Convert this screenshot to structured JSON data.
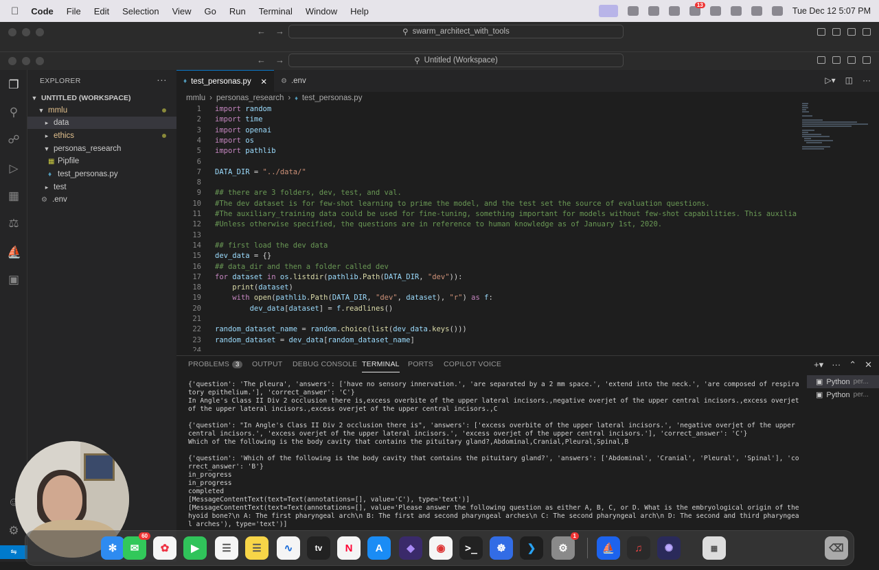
{
  "menubar": {
    "app": "Code",
    "items": [
      "File",
      "Edit",
      "Selection",
      "View",
      "Go",
      "Run",
      "Terminal",
      "Window",
      "Help"
    ],
    "tray_badge": "13",
    "datetime": "Tue Dec 12  5:07 PM"
  },
  "back_window": {
    "search": "swarm_architect_with_tools"
  },
  "window": {
    "search": "Untitled (Workspace)"
  },
  "explorer": {
    "title": "EXPLORER",
    "workspace": "UNTITLED (WORKSPACE)",
    "tree": [
      {
        "label": "mmlu",
        "type": "folder-open"
      },
      {
        "label": "data",
        "type": "folder"
      },
      {
        "label": "ethics",
        "type": "folder"
      },
      {
        "label": "personas_research",
        "type": "folder-open"
      },
      {
        "label": "Pipfile",
        "type": "file"
      },
      {
        "label": "test_personas.py",
        "type": "file"
      },
      {
        "label": "test",
        "type": "folder"
      },
      {
        "label": ".env",
        "type": "file"
      }
    ]
  },
  "tabs": [
    {
      "label": "test_personas.py",
      "active": true
    },
    {
      "label": ".env",
      "active": false
    }
  ],
  "breadcrumbs": [
    "mmlu",
    "personas_research",
    "test_personas.py"
  ],
  "code_lines": [
    "import random",
    "import time",
    "import openai",
    "import os",
    "import pathlib",
    "",
    "DATA_DIR = \"../data/\"",
    "",
    "## there are 3 folders, dev, test, and val.",
    "#The dev dataset is for few-shot learning to prime the model, and the test set the source of evaluation questions.",
    "#The auxiliary_training data could be used for fine-tuning, something important for models without few-shot capabilities. This auxiliary tra",
    "#Unless otherwise specified, the questions are in reference to human knowledge as of January 1st, 2020.",
    "",
    "## first load the dev data",
    "dev_data = {}",
    "## data_dir and then a folder called dev",
    "for dataset in os.listdir(pathlib.Path(DATA_DIR, \"dev\")):",
    "    print(dataset)",
    "    with open(pathlib.Path(DATA_DIR, \"dev\", dataset), \"r\") as f:",
    "        dev_data[dataset] = f.readlines()",
    "",
    "random_dataset_name = random.choice(list(dev_data.keys()))",
    "random_dataset = dev_data[random_dataset_name]",
    ""
  ],
  "panel": {
    "tabs": [
      "PROBLEMS",
      "OUTPUT",
      "DEBUG CONSOLE",
      "TERMINAL",
      "PORTS",
      "COPILOT VOICE"
    ],
    "problems_count": "3",
    "terminals": [
      {
        "name": "Python",
        "suffix": "per..."
      },
      {
        "name": "Python",
        "suffix": "per..."
      }
    ],
    "terminal_output": "{'question': 'The pleura', 'answers': ['have no sensory innervation.', 'are separated by a 2 mm space.', 'extend into the neck.', 'are composed of respiratory epithelium.'], 'correct_answer': 'C'}\nIn Angle's Class II Div 2 occlusion there is,excess overbite of the upper lateral incisors.,negative overjet of the upper central incisors.,excess overjet of the upper lateral incisors.,excess overjet of the upper central incisors.,C\n\n{'question': \"In Angle's Class II Div 2 occlusion there is\", 'answers': ['excess overbite of the upper lateral incisors.', 'negative overjet of the upper central incisors.', 'excess overjet of the upper lateral incisors.', 'excess overjet of the upper central incisors.'], 'correct_answer': 'C'}\nWhich of the following is the body cavity that contains the pituitary gland?,Abdominal,Cranial,Pleural,Spinal,B\n\n{'question': 'Which of the following is the body cavity that contains the pituitary gland?', 'answers': ['Abdominal', 'Cranial', 'Pleural', 'Spinal'], 'correct_answer': 'B'}\nin_progress\nin_progress\ncompleted\n[MessageContentText(text=Text(annotations=[], value='C'), type='text')]\n[MessageContentText(text=Text(annotations=[], value='Please answer the following question as either A, B, C, or D. What is the embryological origin of the hyoid bone?\\n A: The first pharyngeal arch\\n B: The first and second pharyngeal arches\\n C: The second pharyngeal arch\\n D: The second and third pharyngeal arches'), type='text')]"
  },
  "dock": {
    "messages_badge": "60",
    "settings_badge": "1",
    "apps": [
      "Finder",
      "Safari",
      "Messages",
      "Photos",
      "FaceTime",
      "Reminders",
      "Notes",
      "Freeform",
      "TV",
      "News",
      "App Store",
      "Obsidian",
      "Chrome",
      "Terminal",
      "Kubernetes",
      "VS Code",
      "System Settings",
      "Docker",
      "Audio",
      "Perplexity",
      "Archive",
      "Trash"
    ],
    "tv_label": "tv"
  }
}
